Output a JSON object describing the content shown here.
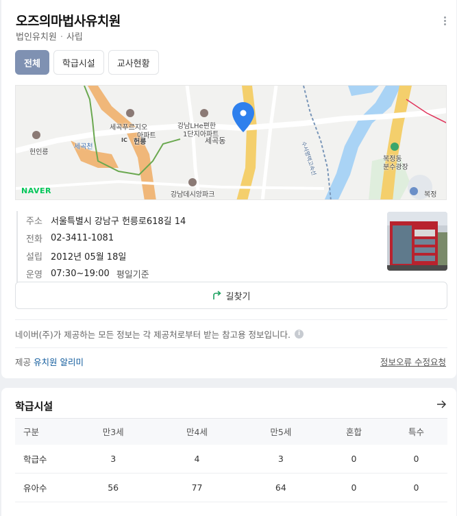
{
  "header": {
    "title": "오즈의마법사유치원",
    "type": "법인유치원",
    "category": "사립"
  },
  "tabs": [
    {
      "label": "전체",
      "active": true
    },
    {
      "label": "학급시설",
      "active": false
    },
    {
      "label": "교사현황",
      "active": false
    }
  ],
  "map": {
    "logo": "NAVER",
    "labels": {
      "l1": "세곡푸르지오",
      "l2": "아파트",
      "l3": "헌릉",
      "l4": "헌인릉",
      "l5": "세곡천",
      "l6": "강남LHe편한",
      "l7": "1단지아파트",
      "l8": "세곡동",
      "l9": "강남데시앙파크",
      "l10": "복정동",
      "l11": "분수광장",
      "l12": "복정",
      "l13": "수서평택고속선",
      "l14": "IC"
    }
  },
  "info": {
    "address_label": "주소",
    "address": "서울특별시 강남구 헌릉로618길 14",
    "phone_label": "전화",
    "phone": "02-3411-1081",
    "founded_label": "설립",
    "founded": "2012년 05월 18일",
    "hours_label": "운영",
    "hours": "07:30~19:00",
    "hours_note": "평일기준"
  },
  "route_button": "길찾기",
  "notice": "네이버(주)가 제공하는 모든 정보는 각 제공처로부터 받는 참고용 정보입니다.",
  "provider": {
    "label": "제공",
    "source": "유치원 알리미",
    "report": "정보오류 수정요청"
  },
  "facility": {
    "title": "학급시설",
    "headers": [
      "구분",
      "만3세",
      "만4세",
      "만5세",
      "혼합",
      "특수"
    ],
    "rows": [
      [
        "학급수",
        "3",
        "4",
        "3",
        "0",
        "0"
      ],
      [
        "유아수",
        "56",
        "77",
        "64",
        "0",
        "0"
      ]
    ]
  },
  "colors": {
    "tab_active": "#7f91b2",
    "link": "#0f5a9c",
    "map_pin": "#2f80ed",
    "naver_green": "#03c75a"
  }
}
